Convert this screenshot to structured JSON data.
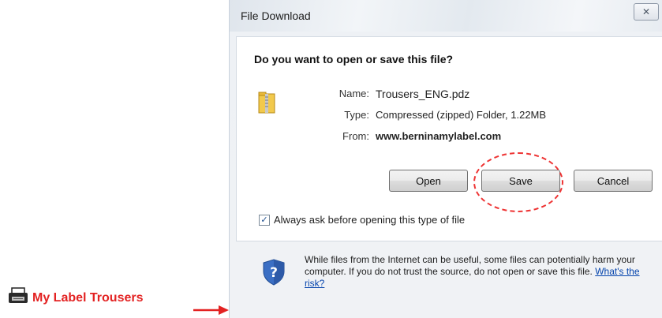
{
  "dialog": {
    "title": "File Download",
    "close_glyph": "✕",
    "question": "Do you want to open or save this file?",
    "file": {
      "name_label": "Name:",
      "name_value": "Trousers_ENG.pdz",
      "type_label": "Type:",
      "type_value": "Compressed (zipped) Folder, 1.22MB",
      "from_label": "From:",
      "from_value": "www.berninamylabel.com"
    },
    "buttons": {
      "open": "Open",
      "save": "Save",
      "cancel": "Cancel"
    },
    "always_ask": {
      "checked": true,
      "label": "Always ask before opening this type of file"
    },
    "warning": {
      "text": "While files from the Internet can be useful, some files can potentially harm your computer. If you do not trust the source, do not open or save this file.",
      "link": "What's the risk?"
    }
  },
  "annotation": {
    "label": "My Label Trousers",
    "color": "#e32222",
    "highlight_color": "#e33333"
  },
  "icons": [
    "folder-zip-icon",
    "shield-question-icon",
    "printer-icon",
    "arrow-right-icon"
  ]
}
